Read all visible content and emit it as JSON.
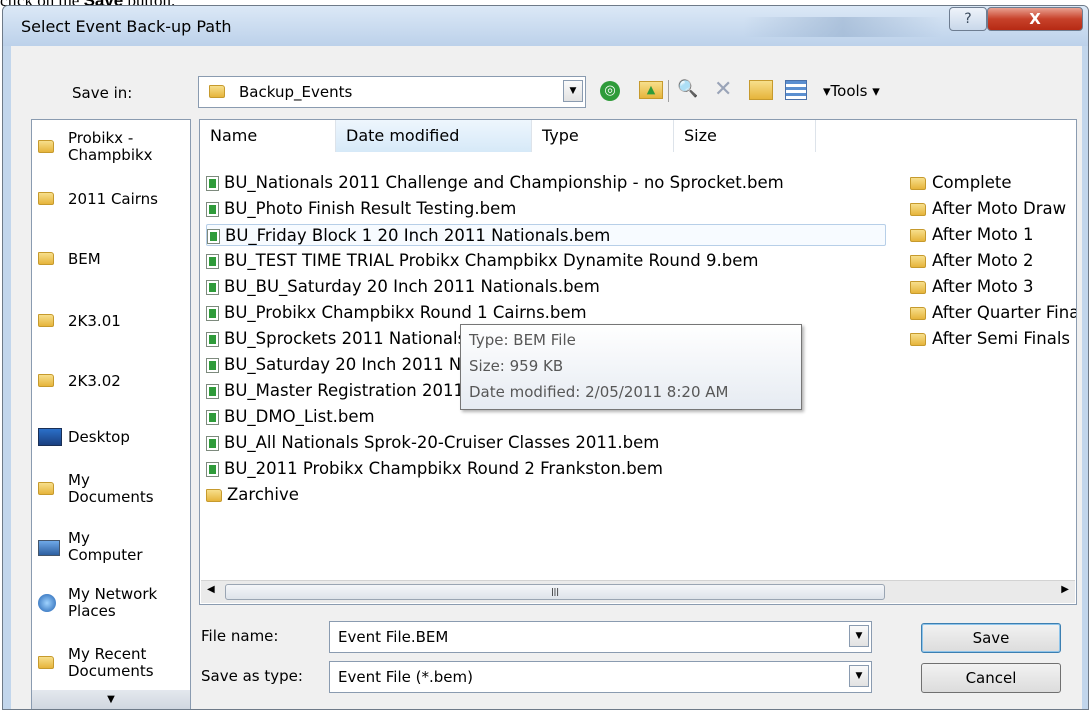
{
  "caption": {
    "prefix": "click on the",
    "bold": "Save",
    "suffix": "button."
  },
  "dialog": {
    "title": "Select Event Back-up Path",
    "help_label": "?",
    "close_label": "X"
  },
  "save_in": {
    "label": "Save in:",
    "value": "Backup_Events"
  },
  "toolbar": {
    "back_glyph": "◎",
    "up_glyph": "▲",
    "search_glyph": "🔍",
    "delete_glyph": "✕",
    "tools_label": "▾Tools ▾"
  },
  "places": [
    {
      "label": "Probikx -\nChampbikx",
      "icon": "folder-icon"
    },
    {
      "label": "2011 Cairns",
      "icon": "folder-icon"
    },
    {
      "label": "BEM",
      "icon": "folder-icon"
    },
    {
      "label": "2K3.01",
      "icon": "folder-icon"
    },
    {
      "label": "2K3.02",
      "icon": "folder-icon"
    },
    {
      "label": "Desktop",
      "icon": "desktop-icon"
    },
    {
      "label": "My\nDocuments",
      "icon": "documents-icon"
    },
    {
      "label": "My\nComputer",
      "icon": "computer-icon"
    },
    {
      "label": "My Network\nPlaces",
      "icon": "network-icon"
    },
    {
      "label": "My Recent\nDocuments",
      "icon": "recent-icon"
    }
  ],
  "columns": [
    "Name",
    "Date modified",
    "Type",
    "Size"
  ],
  "files": [
    "BU_Nationals 2011  Challenge and Championship - no Sprocket.bem",
    "BU_Photo Finish Result Testing.bem",
    "BU_Friday Block 1 20 Inch 2011 Nationals.bem",
    "BU_TEST TIME TRIAL Probikx Champbikx Dynamite Round 9.bem",
    "BU_BU_Saturday 20 Inch 2011 Nationals.bem",
    "BU_Probikx Champbikx Round 1 Cairns.bem",
    "BU_Sprockets 2011 Nationals.bem",
    "BU_Saturday 20 Inch 2011 Nationals.bem",
    "BU_Master Registration 2011 Nationals.bem",
    "BU_DMO_List.bem",
    "BU_All Nationals Sprok-20-Cruiser Classes 2011.bem",
    "BU_2011 Probikx Champbikx Round 2 Frankston.bem"
  ],
  "archive_folder": "Zarchive",
  "right_folders": [
    "Complete",
    "After Moto Draw",
    "After Moto 1",
    "After Moto 2",
    "After Moto 3",
    "After Quarter Finals",
    "After Semi Finals"
  ],
  "tooltip": {
    "type": "Type: BEM File",
    "size": "Size: 959 KB",
    "date": "Date modified: 2/05/2011 8:20 AM"
  },
  "file_name": {
    "label": "File name:",
    "value": "Event File.BEM"
  },
  "save_as_type": {
    "label": "Save as type:",
    "value": "Event File (*.bem)"
  },
  "buttons": {
    "save": "Save",
    "cancel": "Cancel"
  }
}
